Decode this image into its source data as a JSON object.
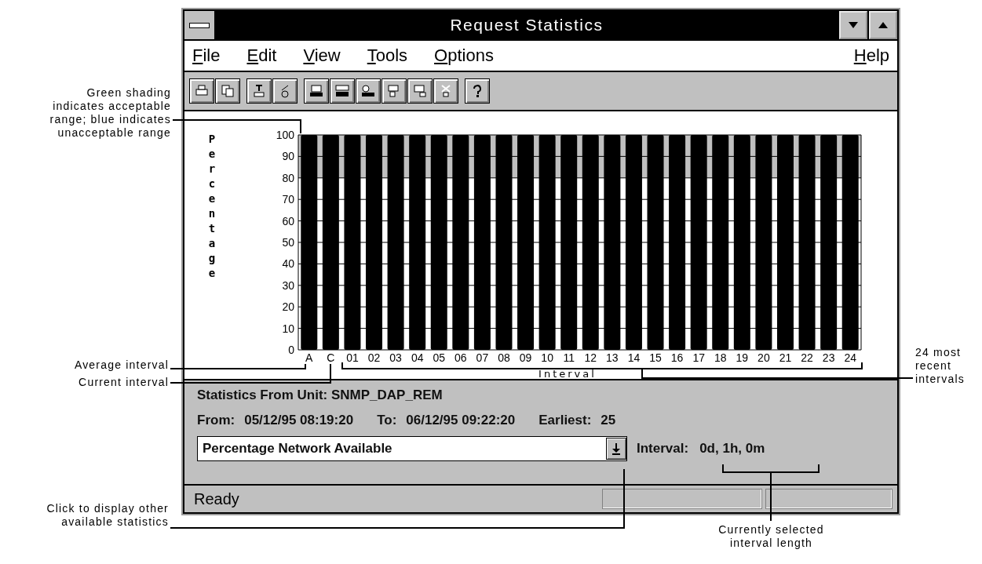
{
  "window": {
    "title": "Request Statistics"
  },
  "menu": {
    "items": [
      "File",
      "Edit",
      "View",
      "Tools",
      "Options"
    ],
    "right_items": [
      "Help"
    ]
  },
  "chart": {
    "chart_data": {
      "type": "bar",
      "ylabel": "Percentage",
      "xlabel": "Interval",
      "categories": [
        "A",
        "C",
        "01",
        "02",
        "03",
        "04",
        "05",
        "06",
        "07",
        "08",
        "09",
        "10",
        "11",
        "12",
        "13",
        "14",
        "15",
        "16",
        "17",
        "18",
        "19",
        "20",
        "21",
        "22",
        "23",
        "24"
      ],
      "values": [
        100,
        100,
        100,
        100,
        100,
        100,
        100,
        100,
        100,
        100,
        100,
        100,
        100,
        100,
        100,
        100,
        100,
        100,
        100,
        100,
        100,
        100,
        100,
        100,
        100,
        100
      ],
      "grid": true,
      "bands": [
        {
          "axis": "y",
          "from": 80,
          "to": 100,
          "color": "#c0c0c0"
        }
      ],
      "ylim": [
        0,
        100
      ],
      "yticks": [
        0,
        10,
        20,
        30,
        40,
        50,
        60,
        70,
        80,
        90,
        100
      ]
    }
  },
  "info": {
    "unit": "Statistics From Unit: SNMP_DAP_REM",
    "from_label": "From:",
    "from": "05/12/95 08:19:20",
    "to_label": "To:",
    "to": "06/12/95 09:22:20",
    "earliest_label": "Earliest:",
    "earliest": "25"
  },
  "statistic": {
    "value": "Percentage Network Available"
  },
  "interval": {
    "label": "Interval:",
    "value": "0d, 1h, 0m"
  },
  "status_bar": {
    "text": "Ready"
  },
  "callouts": [
    {
      "text": "Green shading indicates acceptable range; blue indicates unacceptable range"
    },
    {
      "text": "Average interval"
    },
    {
      "text": "Current interval"
    },
    {
      "text": "24 most recent intervals"
    },
    {
      "text": "Click to display other available statistics"
    },
    {
      "text": "Currently selected interval length"
    }
  ]
}
